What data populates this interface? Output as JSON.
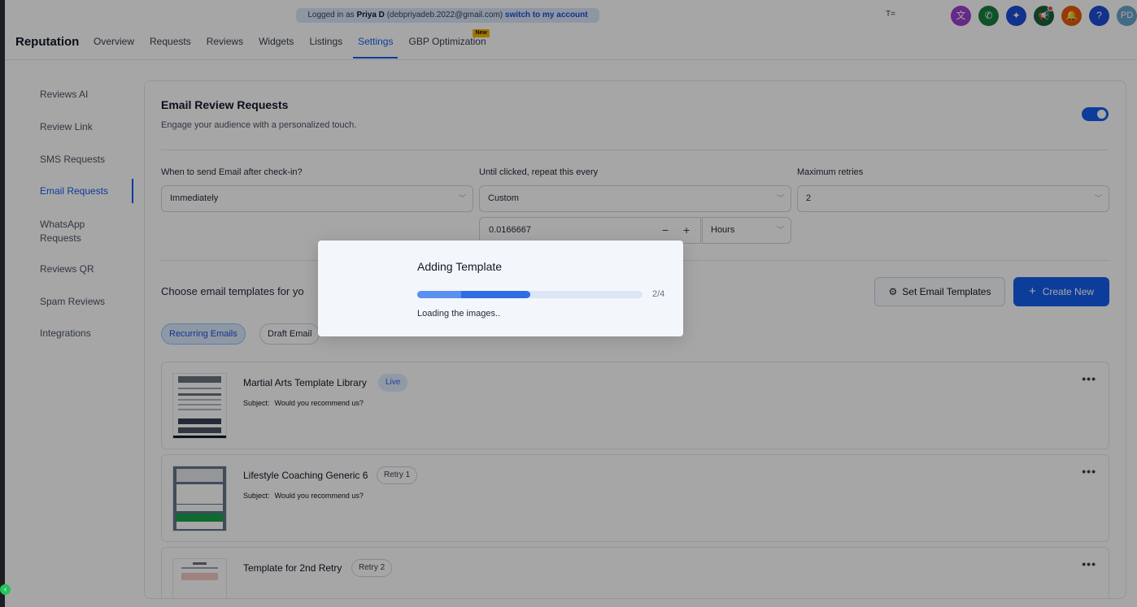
{
  "impersonation": {
    "prefix": "Logged in as",
    "name": "Priya D",
    "email": "(debpriyadeb.2022@gmail.com)",
    "switch_link": "switch to my account"
  },
  "header": {
    "brand": "Reputation",
    "tabs": [
      {
        "label": "Overview"
      },
      {
        "label": "Requests"
      },
      {
        "label": "Reviews"
      },
      {
        "label": "Widgets"
      },
      {
        "label": "Listings"
      },
      {
        "label": "Settings",
        "active": true
      },
      {
        "label": "GBP Optimization",
        "badge": "New"
      }
    ],
    "widget_icon": "T=",
    "icons": [
      {
        "name": "translate-icon",
        "color": "#9b3fd0",
        "glyph": "文"
      },
      {
        "name": "phone-icon",
        "color": "#15803d",
        "glyph": "✆"
      },
      {
        "name": "sparkle-icon",
        "color": "#1d4ed8",
        "glyph": "✦"
      },
      {
        "name": "megaphone-icon",
        "color": "#166534",
        "glyph": "📢"
      },
      {
        "name": "bell-icon",
        "color": "#ea580c",
        "glyph": "🔔"
      },
      {
        "name": "help-icon",
        "color": "#1d4ed8",
        "glyph": "?"
      },
      {
        "name": "avatar",
        "color": "#6ba4c9",
        "glyph": "PD"
      }
    ]
  },
  "sidebar": {
    "items": [
      {
        "label": "Reviews AI"
      },
      {
        "label": "Review Link"
      },
      {
        "label": "SMS Requests"
      },
      {
        "label": "Email Requests",
        "active": true
      },
      {
        "label": "WhatsApp Requests"
      },
      {
        "label": "Reviews QR"
      },
      {
        "label": "Spam Reviews"
      },
      {
        "label": "Integrations"
      }
    ]
  },
  "main": {
    "title": "Email Review Requests",
    "subtitle": "Engage your audience with a personalized touch.",
    "toggle_on": true,
    "when_label": "When to send Email after check-in?",
    "when_value": "Immediately",
    "repeat_label": "Until clicked, repeat this every",
    "repeat_value": "Custom",
    "retries_label": "Maximum retries",
    "retries_value": "2",
    "custom_interval": "0.0166667",
    "minus": "−",
    "plus": "+",
    "interval_unit": "Hours",
    "choose_label": "Choose email templates for yo",
    "set_templates_button": "Set Email Templates",
    "create_new_button": "Create New",
    "filters": [
      {
        "label": "Recurring Emails",
        "active": true
      },
      {
        "label": "Draft Email"
      }
    ],
    "subject_label": "Subject:",
    "templates": [
      {
        "name": "Martial Arts Template Library",
        "badge": "Live",
        "subject": "Would you recommend us?"
      },
      {
        "name": "Lifestyle Coaching Generic 6",
        "badge": "Retry 1",
        "subject": "Would you recommend us?"
      },
      {
        "name": "Template for 2nd Retry",
        "badge": "Retry 2",
        "subject": ""
      }
    ]
  },
  "modal": {
    "title": "Adding Template",
    "progress_current": 2,
    "progress_total": 4,
    "progress_text": "2/4",
    "status": "Loading the images.."
  }
}
